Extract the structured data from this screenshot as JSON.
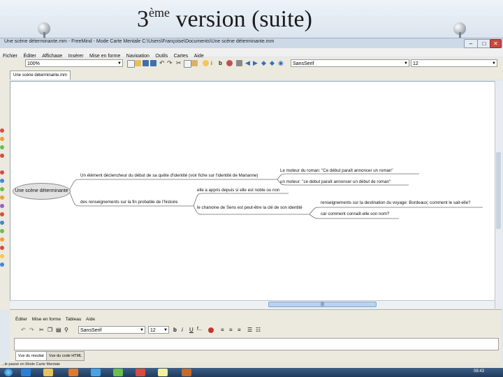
{
  "slide": {
    "title_number": "3",
    "title_superscript": "ème",
    "title_rest": " version (suite)"
  },
  "window": {
    "title": "Une scène déterminante.mm - FreeMind - Mode Carte Mentale C:\\Users\\Françoise\\Documents\\Une scène déterminante.mm",
    "minimize": "–",
    "maximize": "□",
    "close": "✕"
  },
  "menu": [
    "Fichier",
    "Éditer",
    "Affichage",
    "Insérer",
    "Mise en forme",
    "Navigation",
    "Outils",
    "Cartes",
    "Aide"
  ],
  "toolbar": {
    "zoom_value": "100%",
    "font_value": "SansSerif",
    "font_size_value": "12"
  },
  "tabs": [
    "Une scène déterminante.mm"
  ],
  "mindmap": {
    "root": "Une scène déterminante",
    "branch1": "Un élément déclencheur du début de sa quête d'identité (voir fiche sur l'identité de Marianne)",
    "branch1_child1": "Le moteur du roman: \"Ce début paraît annoncer un roman\"",
    "branch1_child2": "un moteur: \"ce début paraît annoncer un début de roman\"",
    "branch2": "des renseignements sur la fin probable de l'histoire",
    "branch2_child1": "elle a appris depuis si elle est noble ou non",
    "branch2_child2": "le chanoine de Sens est peut-être la clé de son identité",
    "branch2_child2_child1": "renseignements sur la destination du voyage: Bordeaux; comment le sait-elle?",
    "branch2_child2_child2": "car comment connaît-elle son nom?"
  },
  "scroll": {
    "h_grip": "|||"
  },
  "editor": {
    "menu": [
      "Éditer",
      "Mise en forme",
      "Tableau",
      "Aide"
    ],
    "font_value": "SansSerif",
    "size_value": "12",
    "bold": "b",
    "italic": "i",
    "underline": "U",
    "font_btn": "f...",
    "tab_result": "Vue du résultat",
    "tab_html": "Vue du code HTML"
  },
  "status": "...le passé en Mode Carte Mentale",
  "taskbar": {
    "clock": "08:43"
  }
}
